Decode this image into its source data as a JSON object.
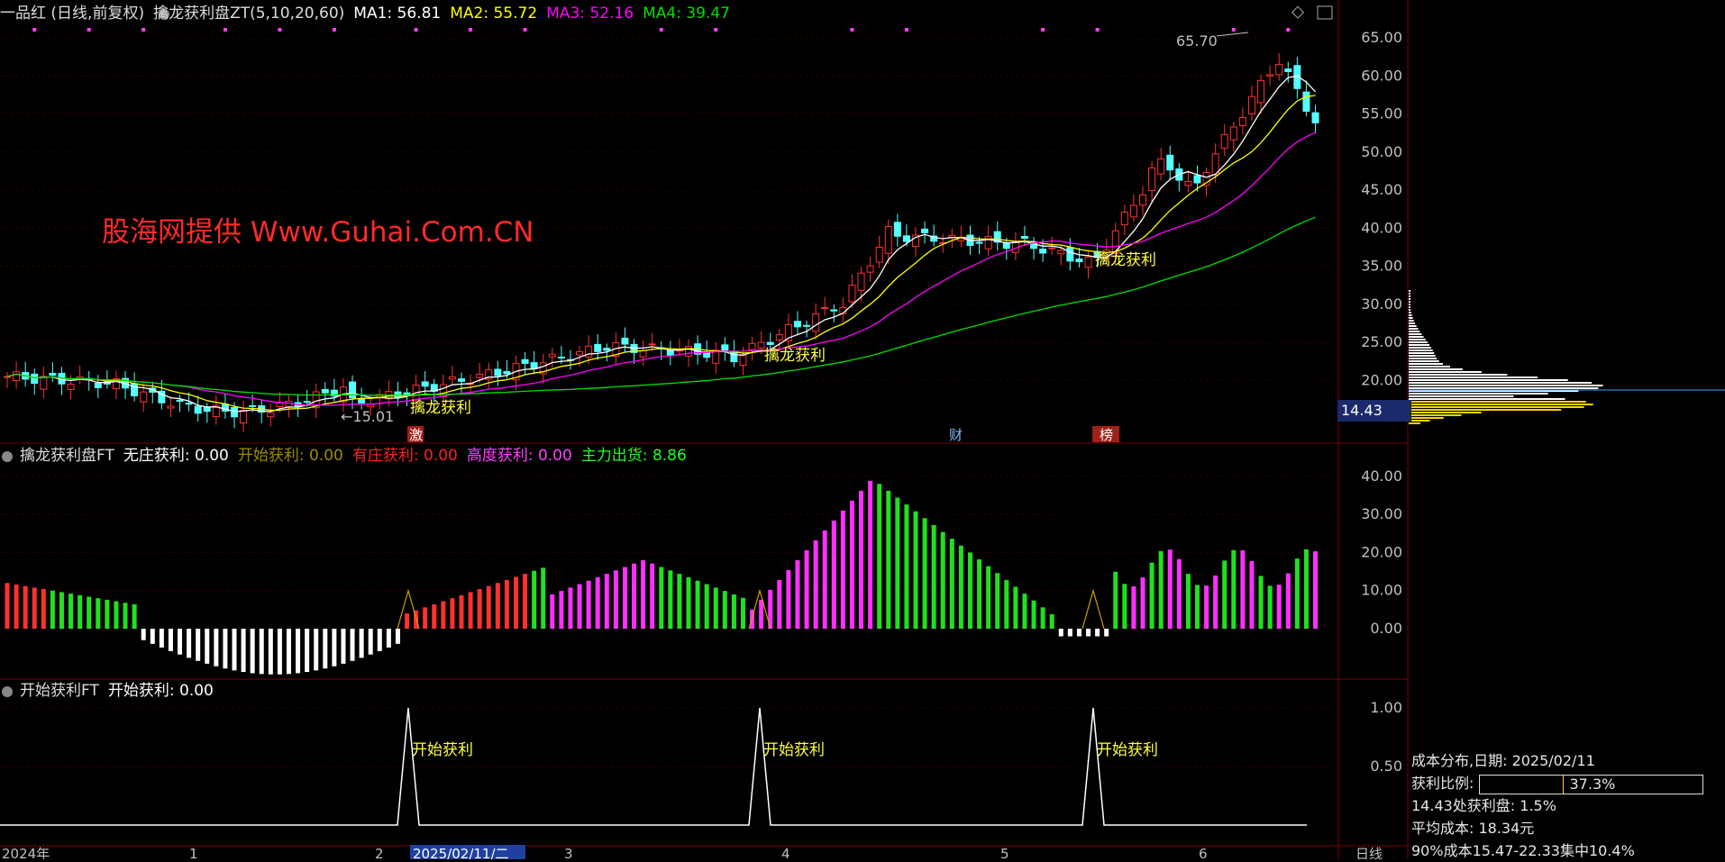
{
  "header1": {
    "stock": "一品红 (日线,前复权)",
    "indicator": "擒龙获利盘ZT(5,10,20,60)",
    "ma1": "MA1: 56.81",
    "ma2": "MA2: 55.72",
    "ma3": "MA3: 52.16",
    "ma4": "MA4: 39.47"
  },
  "header2": {
    "title": "擒龙获利盘FT",
    "v1": "无庄获利: 0.00",
    "v2": "开始获利: 0.00",
    "v3": "有庄获利: 0.00",
    "v4": "高度获利: 0.00",
    "v5": "主力出货: 8.86"
  },
  "header3": {
    "title": "开始获利FT",
    "v1": "开始获利: 0.00"
  },
  "watermark": "股海网提供 Www.Guhai.Com.CN",
  "annotations": {
    "high": "65.70",
    "low": "15.01",
    "signal": "擒龙获利",
    "start": "开始获利",
    "tag_ji": "激",
    "tag_cai": "财",
    "tag_bang": "榜"
  },
  "price_tag": "14.43",
  "axis": {
    "price": [
      "65.00",
      "60.00",
      "55.00",
      "50.00",
      "45.00",
      "40.00",
      "35.00",
      "30.00",
      "25.00",
      "20.00"
    ],
    "indicator": [
      "40.00",
      "30.00",
      "20.00",
      "10.00",
      "0.00"
    ],
    "start": [
      "1.00",
      "0.50"
    ],
    "dates": [
      "2024年",
      "1",
      "2",
      "3",
      "4",
      "5",
      "6"
    ],
    "cursor_date": "2025/02/11/二",
    "period": "日线"
  },
  "info": {
    "title": "成本分布,日期: 2025/02/11",
    "ratio_label": "获利比例:",
    "ratio_value": "37.3%",
    "ratio": 0.373,
    "line1": "14.43处获利盘: 1.5%",
    "line2": "平均成本: 18.34元",
    "line3": "90%成本15.47-22.33集中10.4%"
  },
  "colors": {
    "up": "#ff3030",
    "down": "#54ffff",
    "ma1": "#ffffff",
    "ma2": "#ffff00",
    "ma3": "#ff00ff",
    "ma4": "#00e000"
  }
}
